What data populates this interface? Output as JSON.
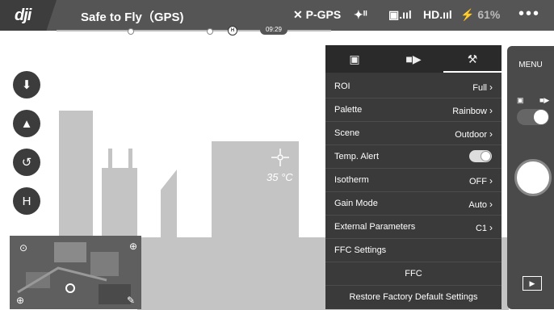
{
  "topbar": {
    "logo": "dji",
    "status": "Safe to Fly（GPS)",
    "flight_mode": "P-GPS",
    "gps_signal": "ᴵᴵ",
    "rc_signal": ".ııl",
    "hd_signal": "HD.ııl",
    "battery_pct": "61%",
    "more": "•••",
    "flight_time": "09:29",
    "home_marker": "H"
  },
  "left_tools": [
    {
      "name": "takeoff-icon",
      "glyph": "⬇"
    },
    {
      "name": "navigation-icon",
      "glyph": "▲"
    },
    {
      "name": "return-home-icon",
      "glyph": "↺"
    },
    {
      "name": "home-point-icon",
      "glyph": "H"
    }
  ],
  "temperature": "35 °C",
  "map": {
    "compass_glyph": "⊙",
    "target_glyph": "⊕",
    "zoom_glyph": "⊕",
    "erase_glyph": "✎"
  },
  "panel": {
    "tabs": [
      {
        "name": "tab-camera",
        "glyph": "▣"
      },
      {
        "name": "tab-video",
        "glyph": "■▶"
      },
      {
        "name": "tab-settings",
        "glyph": "⚒"
      }
    ],
    "rows": [
      {
        "label": "ROI",
        "value": "Full"
      },
      {
        "label": "Palette",
        "value": "Rainbow"
      },
      {
        "label": "Scene",
        "value": "Outdoor"
      },
      {
        "label": "Temp. Alert",
        "toggle": true
      },
      {
        "label": "Isotherm",
        "value": "OFF"
      },
      {
        "label": "Gain Mode",
        "value": "Auto"
      },
      {
        "label": "External Parameters",
        "value": "C1"
      },
      {
        "label": "FFC Settings"
      },
      {
        "label": "FFC"
      },
      {
        "label": "Restore Factory Default Settings"
      }
    ]
  },
  "rightbar": {
    "menu": "MENU",
    "photo_glyph": "▣",
    "video_glyph": "■▶",
    "play_glyph": "▶"
  }
}
